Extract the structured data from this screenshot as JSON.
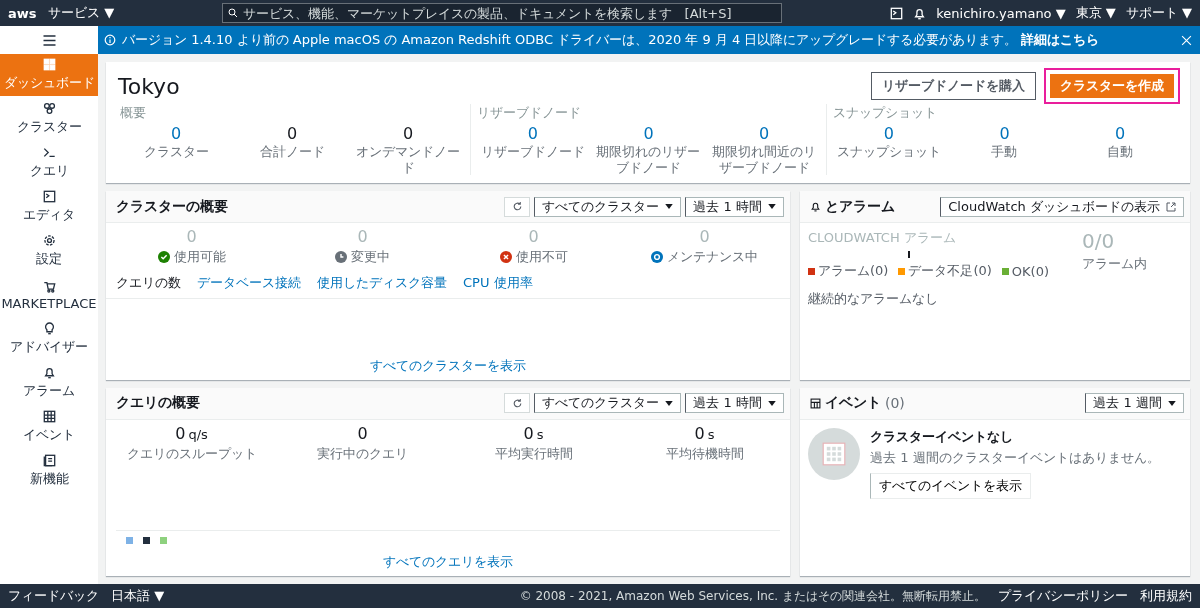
{
  "top_nav": {
    "logo": "aws",
    "services": "サービス ▼",
    "search": {
      "placeholder": "サービス、機能、マーケットプレイスの製品、ドキュメントを検索します   [Alt+S]"
    },
    "user": "kenichiro.yamano ▼",
    "region": "東京 ▼",
    "support": "サポート ▼"
  },
  "banner": {
    "text": "バージョン 1.4.10 より前の Apple macOS の Amazon Redshift ODBC ドライバーは、2020 年 9 月 4 日以降にアップグレードする必要があります。",
    "link": "詳細はこちら"
  },
  "sidebar": {
    "items": [
      {
        "label": "ダッシュボード",
        "selected": true
      },
      {
        "label": "クラスター",
        "selected": false
      },
      {
        "label": "クエリ",
        "selected": false
      },
      {
        "label": "エディタ",
        "selected": false
      },
      {
        "label": "設定",
        "selected": false
      },
      {
        "label": "MARKETPLACE",
        "selected": false
      },
      {
        "label": "アドバイザー",
        "selected": false
      },
      {
        "label": "アラーム",
        "selected": false
      },
      {
        "label": "イベント",
        "selected": false
      },
      {
        "label": "新機能",
        "selected": false
      }
    ]
  },
  "header": {
    "title": "Tokyo",
    "buttons": [
      {
        "label": "リザーブドノードを購入",
        "kind": "secondary",
        "highlighted": false
      },
      {
        "label": "クラスターを作成",
        "kind": "primary",
        "highlighted": true
      }
    ],
    "groups": [
      {
        "label": "概要",
        "stats": [
          {
            "value": "0",
            "label": "クラスター"
          },
          {
            "value": "0",
            "label": "合計ノード"
          },
          {
            "value": "0",
            "label": "オンデマンドノード"
          }
        ]
      },
      {
        "label": "リザーブドノード",
        "stats": [
          {
            "value": "0",
            "label": "リザーブドノード"
          },
          {
            "value": "0",
            "label": "期限切れのリザーブドノード"
          },
          {
            "value": "0",
            "label": "期限切れ間近のリザーブドノード"
          }
        ]
      },
      {
        "label": "スナップショット",
        "stats": [
          {
            "value": "0",
            "label": "スナップショット"
          },
          {
            "value": "0",
            "label": "手動"
          },
          {
            "value": "0",
            "label": "自動"
          }
        ]
      }
    ]
  },
  "cluster_summary": {
    "title": "クラスターの概要",
    "filters": [
      "すべてのクラスター",
      "過去 1 時間"
    ],
    "statuses": [
      {
        "value": "0",
        "label": "使用可能",
        "kind": "ok",
        "color": "#1d8102"
      },
      {
        "value": "0",
        "label": "変更中",
        "kind": "pending",
        "color": "#687078"
      },
      {
        "value": "0",
        "label": "使用不可",
        "kind": "error",
        "color": "#d13212"
      },
      {
        "value": "0",
        "label": "メンテナンス中",
        "kind": "maintenance",
        "color": "#0073bb"
      }
    ],
    "tabs": [
      {
        "label": "クエリの数",
        "selected": true
      },
      {
        "label": "データベース接続",
        "selected": false
      },
      {
        "label": "使用したディスク容量",
        "selected": false
      },
      {
        "label": "CPU 使用率",
        "selected": false
      }
    ],
    "link": "すべてのクラスターを表示"
  },
  "query_summary": {
    "title": "クエリの概要",
    "filters": [
      "すべてのクラスター",
      "過去 1 時間"
    ],
    "stats": [
      {
        "value": "0",
        "unit": "q/s",
        "label": "クエリのスループット"
      },
      {
        "value": "0",
        "label": "実行中のクエリ"
      },
      {
        "value": "0",
        "unit": "s",
        "label": "平均実行時間"
      },
      {
        "value": "0",
        "unit": "s",
        "label": "平均待機時間"
      }
    ],
    "legend": [
      {
        "color": "#7eb2e6"
      },
      {
        "color": "#232f3e"
      },
      {
        "color": "#8ed17e"
      }
    ],
    "link": "すべてのクエリを表示"
  },
  "alarms": {
    "title": "とアラーム",
    "button": "CloudWatch ダッシュボードの表示",
    "section": "CLOUDWATCH アラーム",
    "legend": [
      {
        "label": "アラーム(0)",
        "color": "#d13212"
      },
      {
        "label": "データ不足(0)",
        "color": "#ff9900"
      },
      {
        "label": "OK(0)",
        "color": "#6aaf35"
      }
    ],
    "count": "0/0",
    "count_label": "アラーム内",
    "empty": "継続的なアラームなし"
  },
  "events": {
    "title": "イベント",
    "count": "(0)",
    "filter": "過去 1 週間",
    "empty_title": "クラスターイベントなし",
    "empty_text": "過去 1 週間のクラスターイベントはありません。",
    "button": "すべてのイベントを表示"
  },
  "footer": {
    "feedback": "フィードバック",
    "language": "日本語 ▼",
    "copyright": "© 2008 - 2021, Amazon Web Services, Inc. またはその関連会社。無断転用禁止。",
    "links": [
      "プライバシーポリシー",
      "利用規約"
    ]
  }
}
